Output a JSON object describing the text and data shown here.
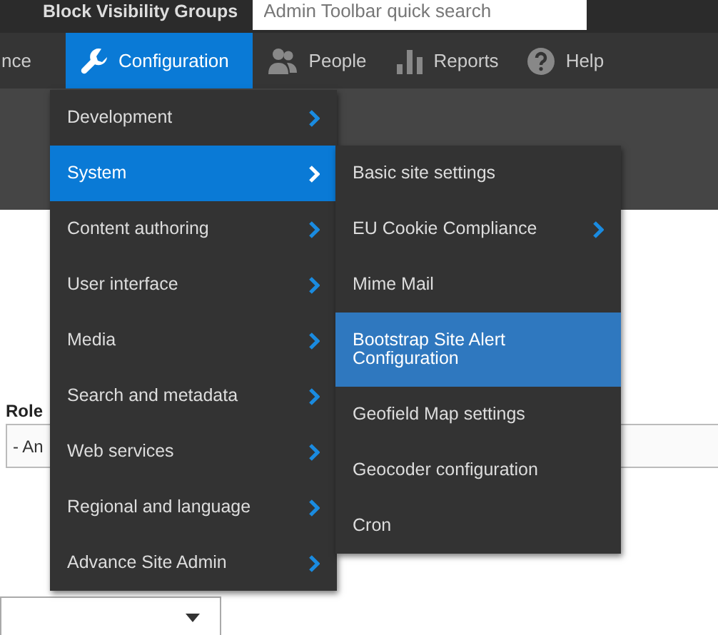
{
  "top_bar": {
    "title": "Block Visibility Groups",
    "search": {
      "placeholder": "Admin Toolbar quick search"
    }
  },
  "nav": [
    {
      "label": "nce",
      "selected": false
    },
    {
      "label": "Configuration",
      "selected": true
    },
    {
      "label": "People",
      "selected": false
    },
    {
      "label": "Reports",
      "selected": false
    },
    {
      "label": "Help",
      "selected": false
    }
  ],
  "menu": {
    "items": [
      {
        "label": "Development",
        "selected": false,
        "has_children": true
      },
      {
        "label": "System",
        "selected": true,
        "has_children": true
      },
      {
        "label": "Content authoring",
        "selected": false,
        "has_children": true
      },
      {
        "label": "User interface",
        "selected": false,
        "has_children": true
      },
      {
        "label": "Media",
        "selected": false,
        "has_children": true
      },
      {
        "label": "Search and metadata",
        "selected": false,
        "has_children": true
      },
      {
        "label": "Web services",
        "selected": false,
        "has_children": true
      },
      {
        "label": "Regional and language",
        "selected": false,
        "has_children": true
      },
      {
        "label": "Advance Site Admin",
        "selected": false,
        "has_children": true
      }
    ]
  },
  "submenu": {
    "items": [
      {
        "label": "Basic site settings",
        "selected": false,
        "has_children": false
      },
      {
        "label": "EU Cookie Compliance",
        "selected": false,
        "has_children": true
      },
      {
        "label": "Mime Mail",
        "selected": false,
        "has_children": false
      },
      {
        "label": "Bootstrap Site Alert Configuration",
        "selected": true,
        "has_children": false
      },
      {
        "label": "Geofield Map settings",
        "selected": false,
        "has_children": false
      },
      {
        "label": "Geocoder configuration",
        "selected": false,
        "has_children": false
      },
      {
        "label": "Cron",
        "selected": false,
        "has_children": false
      }
    ]
  },
  "content": {
    "role_label": "Role",
    "role_select": {
      "value": "- An"
    }
  }
}
